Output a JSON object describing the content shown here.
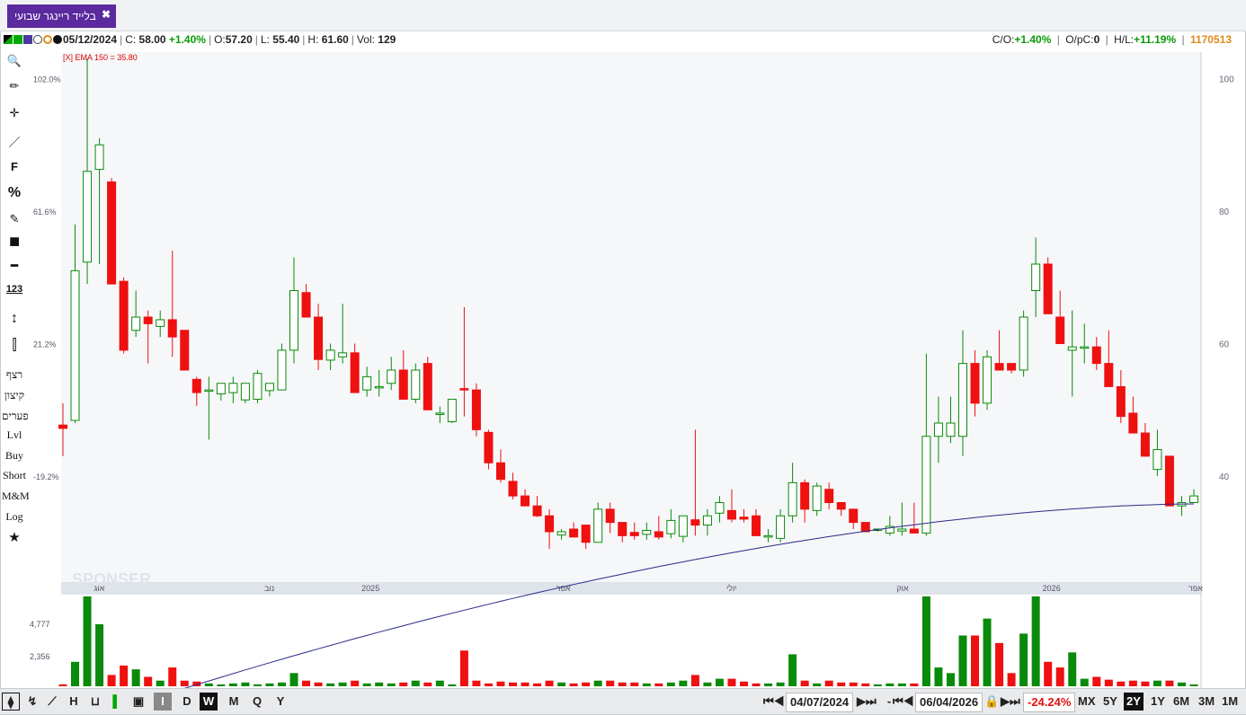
{
  "window": {
    "tab_title": "בלייד ריינגר שבועי",
    "tab_close": "✖"
  },
  "infobar": {
    "date": "05/12/2024",
    "close_label": "C:",
    "close_value": "58.00",
    "change_pct": "+1.40%",
    "open_label": "O:",
    "open_value": "57.20",
    "low_label": "L:",
    "low_value": "55.40",
    "high_label": "H:",
    "high_value": "61.60",
    "vol_label": "Vol:",
    "vol_value": "129",
    "co_label": "C/O:",
    "co_value": "+1.40%",
    "opc_label": "O/pC:",
    "opc_value": "0",
    "hl_label": "H/L:",
    "hl_value": "+11.19%",
    "symbol_id": "1170513",
    "indicator_label": "[X] EMA 150 = 35.80"
  },
  "toolbar": {
    "items": [
      "🔍",
      "✏",
      "✛",
      "／",
      "F",
      "%",
      "✎",
      "■",
      "━",
      "123",
      "↕",
      "⫿"
    ],
    "text_items": [
      "רצף",
      "קיצון",
      "פערים",
      "Lvl",
      "Buy",
      "Short",
      "M&M",
      "Log",
      "★"
    ]
  },
  "bottombar": {
    "timeframes": [
      "I",
      "D",
      "W",
      "M",
      "Q",
      "Y"
    ],
    "active_timeframe": "W",
    "start_date": "04/07/2024",
    "end_date": "06/04/2026",
    "change": "-24.24%",
    "ranges": [
      "MX",
      "5Y",
      "2Y",
      "1Y",
      "6M",
      "3M",
      "1M"
    ],
    "active_range": "2Y"
  },
  "colors": {
    "up": "#0a8a0a",
    "down": "#ef1010",
    "ema": "#2a2a8a",
    "tab": "#5b2a9e"
  },
  "chart_data": {
    "type": "candlestick",
    "y_right_ticks": [
      100,
      80,
      60,
      40
    ],
    "y_left_ticks": [
      "102.0%",
      "61.6%",
      "21.2%",
      "-19.2%"
    ],
    "ylim": [
      24,
      104
    ],
    "x_labels": [
      "אוג",
      "נוב",
      "2025",
      "אפר",
      "יולי",
      "אוק",
      "2026",
      "אפר"
    ],
    "volume_ticks": [
      "4,777",
      "2,356"
    ],
    "ema": {
      "name": "EMA 150",
      "value": 35.8
    },
    "watermark": "SPONSER",
    "candles": [
      {
        "o": 47.7,
        "h": 51.0,
        "l": 43.0,
        "c": 47.2,
        "v": 100
      },
      {
        "o": 48.4,
        "h": 78.0,
        "l": 48.0,
        "c": 71.0,
        "v": 1300
      },
      {
        "o": 72.3,
        "h": 103.0,
        "l": 69.0,
        "c": 86.0,
        "v": 4777
      },
      {
        "o": 86.3,
        "h": 91.0,
        "l": 72.0,
        "c": 90.0,
        "v": 3300
      },
      {
        "o": 84.4,
        "h": 85.0,
        "l": 69.0,
        "c": 69.0,
        "v": 600
      },
      {
        "o": 69.4,
        "h": 70.0,
        "l": 58.5,
        "c": 59.0,
        "v": 1100
      },
      {
        "o": 62.0,
        "h": 68.0,
        "l": 61.0,
        "c": 64.0,
        "v": 900
      },
      {
        "o": 64.0,
        "h": 65.0,
        "l": 57.0,
        "c": 63.0,
        "v": 500
      },
      {
        "o": 62.6,
        "h": 65.0,
        "l": 61.0,
        "c": 63.6,
        "v": 300
      },
      {
        "o": 63.6,
        "h": 74.0,
        "l": 58.0,
        "c": 61.0,
        "v": 1000
      },
      {
        "o": 62.0,
        "h": 62.0,
        "l": 56.0,
        "c": 56.0,
        "v": 300
      },
      {
        "o": 54.6,
        "h": 55.0,
        "l": 50.6,
        "c": 52.6,
        "v": 250
      },
      {
        "o": 53.0,
        "h": 55.0,
        "l": 45.5,
        "c": 53.0,
        "v": 150
      },
      {
        "o": 52.4,
        "h": 54.0,
        "l": 51.4,
        "c": 54.0,
        "v": 100
      },
      {
        "o": 52.6,
        "h": 55.0,
        "l": 51.0,
        "c": 54.0,
        "v": 150
      },
      {
        "o": 51.5,
        "h": 54.0,
        "l": 51.0,
        "c": 54.0,
        "v": 200
      },
      {
        "o": 51.6,
        "h": 56.0,
        "l": 51.0,
        "c": 55.5,
        "v": 100
      },
      {
        "o": 52.9,
        "h": 54.0,
        "l": 52.0,
        "c": 54.0,
        "v": 150
      },
      {
        "o": 53.0,
        "h": 60.0,
        "l": 53.0,
        "c": 59.0,
        "v": 200
      },
      {
        "o": 59.0,
        "h": 73.0,
        "l": 57.0,
        "c": 68.0,
        "v": 700
      },
      {
        "o": 67.7,
        "h": 69.0,
        "l": 64.0,
        "c": 64.0,
        "v": 300
      },
      {
        "o": 64.0,
        "h": 66.0,
        "l": 56.0,
        "c": 57.6,
        "v": 200
      },
      {
        "o": 57.5,
        "h": 60.0,
        "l": 56.0,
        "c": 59.0,
        "v": 150
      },
      {
        "o": 58.0,
        "h": 66.0,
        "l": 57.0,
        "c": 58.6,
        "v": 200
      },
      {
        "o": 58.6,
        "h": 60.0,
        "l": 52.6,
        "c": 52.6,
        "v": 300
      },
      {
        "o": 53.0,
        "h": 56.5,
        "l": 52.0,
        "c": 55.0,
        "v": 150
      },
      {
        "o": 53.5,
        "h": 56.0,
        "l": 52.0,
        "c": 53.5,
        "v": 200
      },
      {
        "o": 54.0,
        "h": 58.0,
        "l": 53.0,
        "c": 56.0,
        "v": 150
      },
      {
        "o": 56.0,
        "h": 59.0,
        "l": 52.5,
        "c": 51.6,
        "v": 200
      },
      {
        "o": 51.6,
        "h": 57.0,
        "l": 51.0,
        "c": 56.0,
        "v": 300
      },
      {
        "o": 57.0,
        "h": 58.0,
        "l": 50.0,
        "c": 50.0,
        "v": 200
      },
      {
        "o": 49.5,
        "h": 50.5,
        "l": 48.0,
        "c": 49.5,
        "v": 300
      },
      {
        "o": 48.2,
        "h": 51.6,
        "l": 48.0,
        "c": 51.6,
        "v": 100
      },
      {
        "o": 53.2,
        "h": 65.5,
        "l": 49.0,
        "c": 53.0,
        "v": 1900
      },
      {
        "o": 53.0,
        "h": 54.0,
        "l": 46.0,
        "c": 47.0,
        "v": 300
      },
      {
        "o": 46.6,
        "h": 47.0,
        "l": 41.0,
        "c": 42.0,
        "v": 150
      },
      {
        "o": 42.0,
        "h": 44.0,
        "l": 39.0,
        "c": 39.5,
        "v": 250
      },
      {
        "o": 39.2,
        "h": 40.5,
        "l": 36.5,
        "c": 37.0,
        "v": 200
      },
      {
        "o": 37.0,
        "h": 38.0,
        "l": 35.5,
        "c": 35.5,
        "v": 200
      },
      {
        "o": 35.5,
        "h": 37.0,
        "l": 33.8,
        "c": 34.0,
        "v": 150
      },
      {
        "o": 34.0,
        "h": 35.0,
        "l": 29.0,
        "c": 31.6,
        "v": 300
      },
      {
        "o": 31.1,
        "h": 32.0,
        "l": 30.4,
        "c": 31.6,
        "v": 200
      },
      {
        "o": 32.0,
        "h": 33.0,
        "l": 30.8,
        "c": 30.8,
        "v": 150
      },
      {
        "o": 32.6,
        "h": 32.6,
        "l": 29.0,
        "c": 30.0,
        "v": 200
      },
      {
        "o": 30.0,
        "h": 36.0,
        "l": 30.0,
        "c": 35.0,
        "v": 300
      },
      {
        "o": 35.0,
        "h": 36.0,
        "l": 31.4,
        "c": 33.0,
        "v": 300
      },
      {
        "o": 33.0,
        "h": 33.0,
        "l": 30.0,
        "c": 31.0,
        "v": 200
      },
      {
        "o": 31.5,
        "h": 33.0,
        "l": 30.4,
        "c": 31.0,
        "v": 200
      },
      {
        "o": 31.2,
        "h": 33.0,
        "l": 30.4,
        "c": 31.8,
        "v": 150
      },
      {
        "o": 31.6,
        "h": 34.0,
        "l": 30.4,
        "c": 30.8,
        "v": 150
      },
      {
        "o": 31.3,
        "h": 35.0,
        "l": 30.6,
        "c": 33.3,
        "v": 200
      },
      {
        "o": 30.9,
        "h": 34.0,
        "l": 30.0,
        "c": 34.0,
        "v": 300
      },
      {
        "o": 33.4,
        "h": 47.0,
        "l": 31.0,
        "c": 32.6,
        "v": 600
      },
      {
        "o": 32.6,
        "h": 35.0,
        "l": 31.0,
        "c": 34.0,
        "v": 200
      },
      {
        "o": 34.4,
        "h": 37.0,
        "l": 33.0,
        "c": 36.0,
        "v": 400
      },
      {
        "o": 34.8,
        "h": 38.0,
        "l": 33.0,
        "c": 33.5,
        "v": 400
      },
      {
        "o": 33.8,
        "h": 35.0,
        "l": 33.0,
        "c": 33.5,
        "v": 250
      },
      {
        "o": 34.0,
        "h": 35.0,
        "l": 31.0,
        "c": 31.0,
        "v": 150
      },
      {
        "o": 31.0,
        "h": 32.0,
        "l": 30.0,
        "c": 31.0,
        "v": 150
      },
      {
        "o": 30.6,
        "h": 35.0,
        "l": 30.0,
        "c": 34.0,
        "v": 200
      },
      {
        "o": 34.0,
        "h": 42.0,
        "l": 33.0,
        "c": 39.0,
        "v": 1700
      },
      {
        "o": 39.0,
        "h": 39.5,
        "l": 33.0,
        "c": 35.0,
        "v": 300
      },
      {
        "o": 34.8,
        "h": 39.0,
        "l": 34.0,
        "c": 38.5,
        "v": 150
      },
      {
        "o": 38.0,
        "h": 39.0,
        "l": 35.0,
        "c": 36.0,
        "v": 300
      },
      {
        "o": 36.0,
        "h": 36.0,
        "l": 34.0,
        "c": 35.0,
        "v": 200
      },
      {
        "o": 35.0,
        "h": 35.0,
        "l": 32.0,
        "c": 33.0,
        "v": 200
      },
      {
        "o": 33.0,
        "h": 33.0,
        "l": 31.6,
        "c": 31.6,
        "v": 150
      },
      {
        "o": 32.0,
        "h": 32.0,
        "l": 31.6,
        "c": 32.0,
        "v": 100
      },
      {
        "o": 31.4,
        "h": 34.0,
        "l": 31.0,
        "c": 32.4,
        "v": 150
      },
      {
        "o": 31.7,
        "h": 36.0,
        "l": 31.0,
        "c": 32.0,
        "v": 150
      },
      {
        "o": 32.0,
        "h": 36.0,
        "l": 31.4,
        "c": 31.4,
        "v": 150
      },
      {
        "o": 31.4,
        "h": 58.5,
        "l": 31.0,
        "c": 46.0,
        "v": 4777
      },
      {
        "o": 46.0,
        "h": 52.0,
        "l": 42.0,
        "c": 48.0,
        "v": 1000
      },
      {
        "o": 46.0,
        "h": 52.0,
        "l": 45.0,
        "c": 48.0,
        "v": 700
      },
      {
        "o": 46.0,
        "h": 62.0,
        "l": 43.0,
        "c": 57.0,
        "v": 2700
      },
      {
        "o": 57.0,
        "h": 59.0,
        "l": 49.0,
        "c": 51.0,
        "v": 2700
      },
      {
        "o": 51.0,
        "h": 59.0,
        "l": 50.0,
        "c": 58.0,
        "v": 3600
      },
      {
        "o": 57.0,
        "h": 62.0,
        "l": 56.0,
        "c": 56.0,
        "v": 2300
      },
      {
        "o": 57.0,
        "h": 57.0,
        "l": 55.5,
        "c": 56.0,
        "v": 700
      },
      {
        "o": 56.0,
        "h": 65.0,
        "l": 55.0,
        "c": 64.0,
        "v": 2800
      },
      {
        "o": 68.0,
        "h": 76.0,
        "l": 64.0,
        "c": 72.0,
        "v": 4777
      },
      {
        "o": 72.0,
        "h": 73.0,
        "l": 64.5,
        "c": 64.5,
        "v": 1300
      },
      {
        "o": 64.0,
        "h": 68.0,
        "l": 60.0,
        "c": 60.0,
        "v": 1000
      },
      {
        "o": 59.0,
        "h": 65.0,
        "l": 52.0,
        "c": 59.5,
        "v": 1800
      },
      {
        "o": 59.5,
        "h": 63.0,
        "l": 57.0,
        "c": 59.5,
        "v": 400
      },
      {
        "o": 59.5,
        "h": 61.0,
        "l": 56.0,
        "c": 57.0,
        "v": 500
      },
      {
        "o": 57.0,
        "h": 62.0,
        "l": 55.0,
        "c": 53.5,
        "v": 350
      },
      {
        "o": 53.5,
        "h": 56.0,
        "l": 48.0,
        "c": 49.0,
        "v": 250
      },
      {
        "o": 49.5,
        "h": 52.0,
        "l": 48.0,
        "c": 46.5,
        "v": 300
      },
      {
        "o": 46.5,
        "h": 48.0,
        "l": 43.0,
        "c": 43.0,
        "v": 250
      },
      {
        "o": 41.0,
        "h": 47.0,
        "l": 40.0,
        "c": 44.0,
        "v": 300
      },
      {
        "o": 43.0,
        "h": 43.0,
        "l": 36.0,
        "c": 35.5,
        "v": 300
      },
      {
        "o": 35.5,
        "h": 37.0,
        "l": 34.0,
        "c": 36.0,
        "v": 200
      },
      {
        "o": 36.0,
        "h": 38.0,
        "l": 36.0,
        "c": 37.0,
        "v": 100
      }
    ]
  }
}
